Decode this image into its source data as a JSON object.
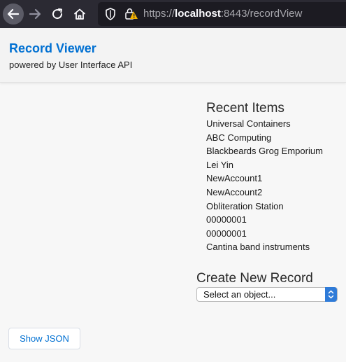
{
  "browser": {
    "url_scheme": "https://",
    "url_host": "localhost",
    "url_rest": ":8443/recordView",
    "icons": [
      "back-icon",
      "forward-icon",
      "reload-icon",
      "home-icon",
      "shield-icon",
      "lock-icon"
    ]
  },
  "header": {
    "title": "Record Viewer",
    "subtitle": "powered by User Interface API",
    "title_color": "#0070d2"
  },
  "recent": {
    "title": "Recent Items",
    "items": [
      "Universal Containers",
      "ABC Computing",
      "Blackbeards Grog Emporium",
      "Lei Yin",
      "NewAccount1",
      "NewAccount2",
      "Obliteration Station",
      "00000001",
      "00000001",
      "Cantina band instruments"
    ]
  },
  "create": {
    "title": "Create New Record",
    "select_value": "Select an object..."
  },
  "actions": {
    "show_json_label": "Show JSON"
  }
}
